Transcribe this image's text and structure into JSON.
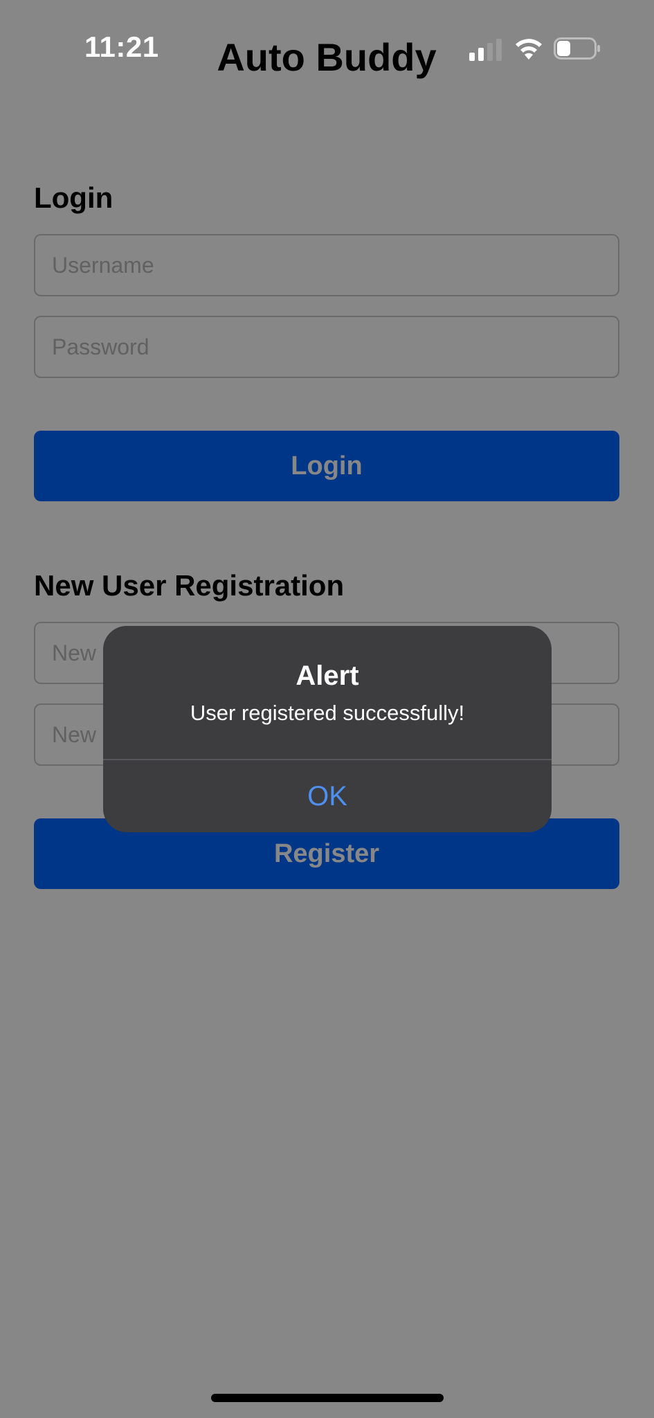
{
  "status_bar": {
    "time": "11:21",
    "signal_icon": "cellular-signal-icon",
    "wifi_icon": "wifi-icon",
    "battery_icon": "battery-icon"
  },
  "app": {
    "title": "Auto Buddy"
  },
  "login": {
    "heading": "Login",
    "username_placeholder": "Username",
    "password_placeholder": "Password",
    "button_label": "Login"
  },
  "registration": {
    "heading": "New User Registration",
    "new_username_placeholder": "New Username",
    "new_password_placeholder": "New Password",
    "button_label": "Register"
  },
  "alert": {
    "title": "Alert",
    "message": "User registered successfully!",
    "ok_label": "OK"
  },
  "colors": {
    "primary_button": "#0066ff",
    "alert_background": "#3d3d3f",
    "alert_action": "#4d90f0",
    "overlay": "rgba(0,0,0,0.47)"
  }
}
